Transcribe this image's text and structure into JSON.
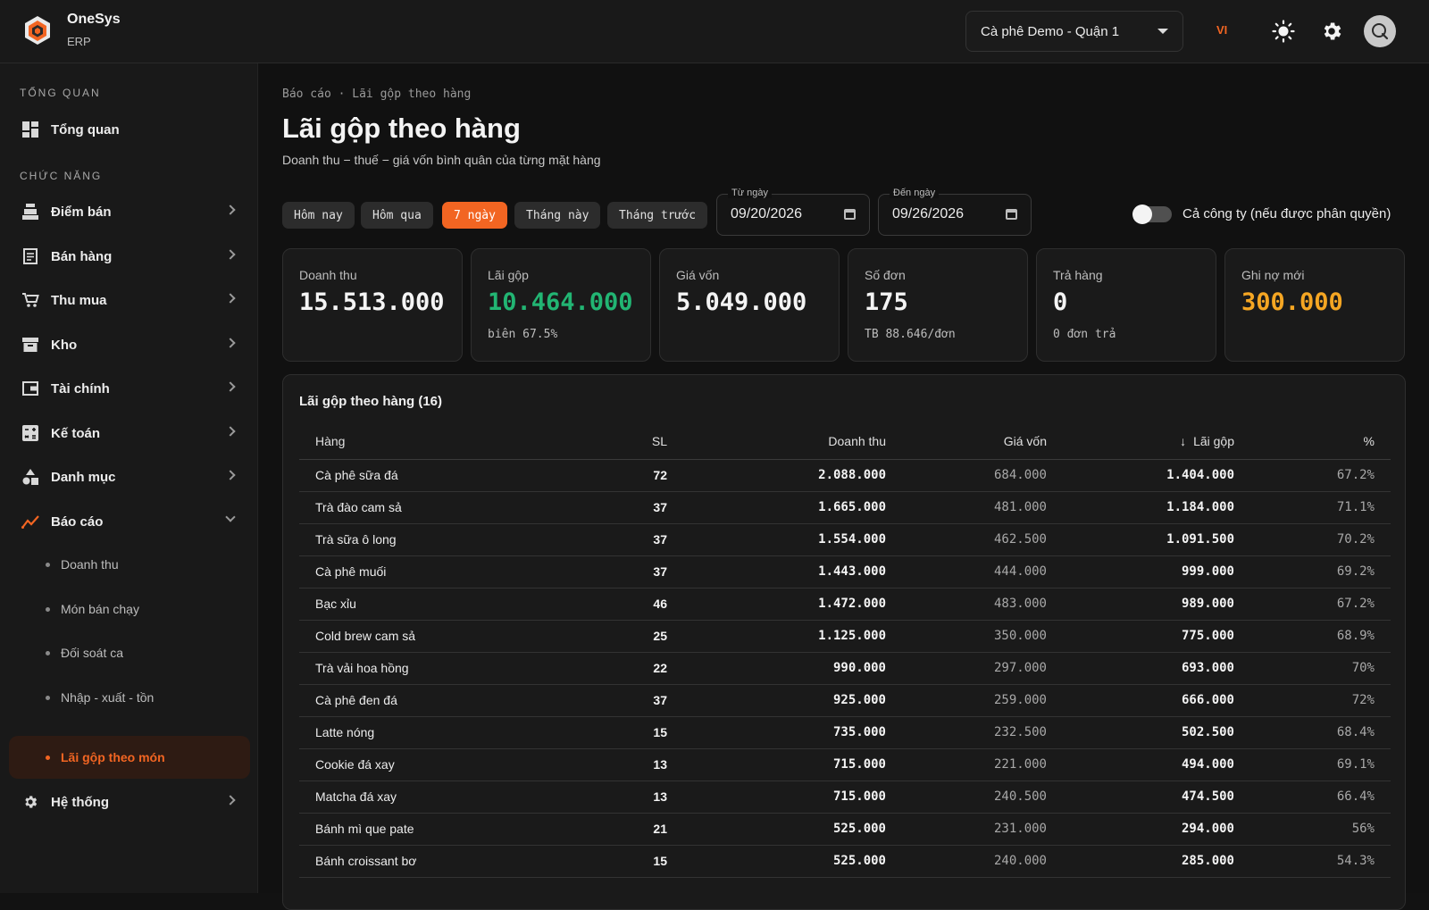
{
  "brand": {
    "name": "OneSys",
    "sub": "ERP"
  },
  "topbar": {
    "store": "Cà phê Demo - Quận 1",
    "lang": "VI"
  },
  "sidebar": {
    "section_overview": "TỔNG QUAN",
    "overview_item": "Tổng quan",
    "section_functions": "CHỨC NĂNG",
    "items": [
      {
        "label": "Điểm bán",
        "icon": "cash-register-icon"
      },
      {
        "label": "Bán hàng",
        "icon": "receipt-icon"
      },
      {
        "label": "Thu mua",
        "icon": "cart-icon"
      },
      {
        "label": "Kho",
        "icon": "archive-icon"
      },
      {
        "label": "Tài chính",
        "icon": "wallet-icon"
      },
      {
        "label": "Kế toán",
        "icon": "calculator-icon"
      },
      {
        "label": "Danh mục",
        "icon": "shapes-icon"
      },
      {
        "label": "Báo cáo",
        "icon": "chart-line-icon"
      }
    ],
    "report_subitems": [
      "Doanh thu",
      "Món bán chạy",
      "Đối soát ca",
      "Nhập - xuất - tồn",
      "Lãi gộp theo món"
    ],
    "system_item": "Hệ thống"
  },
  "main": {
    "breadcrumb": "Báo cáo · Lãi gộp theo hàng",
    "title": "Lãi gộp theo hàng",
    "subtitle": "Doanh thu − thuế − giá vốn bình quân của từng mặt hàng",
    "filters": [
      "Hôm nay",
      "Hôm qua",
      "7 ngày",
      "Tháng này",
      "Tháng trước"
    ],
    "active_filter": "7 ngày",
    "from_label": "Từ ngày",
    "from_value": "09/20/2026",
    "to_label": "Đến ngày",
    "to_value": "09/26/2026",
    "company_toggle_label": "Cả công ty (nếu được phân quyền)",
    "company_toggle_on": false
  },
  "kpis": [
    {
      "label": "Doanh thu",
      "value": "15.513.000",
      "note": ""
    },
    {
      "label": "Lãi gộp",
      "value": "10.464.000",
      "note": "biên 67.5%"
    },
    {
      "label": "Giá vốn",
      "value": "5.049.000",
      "note": ""
    },
    {
      "label": "Số đơn",
      "value": "175",
      "note": "TB 88.646/đơn"
    },
    {
      "label": "Trả hàng",
      "value": "0",
      "note": "0 đơn trả"
    },
    {
      "label": "Ghi nợ mới",
      "value": "300.000",
      "note": ""
    }
  ],
  "colors": {
    "accent": "#f26522",
    "profit": "#22b573",
    "debt": "#f5a623"
  },
  "table": {
    "title": "Lãi gộp theo hàng (16)",
    "headers": [
      "Hàng",
      "SL",
      "Doanh thu",
      "Giá vốn",
      "Lãi gộp",
      "%"
    ],
    "rows": [
      [
        "Cà phê sữa đá",
        "72",
        "2.088.000",
        "684.000",
        "1.404.000",
        "67.2%"
      ],
      [
        "Trà đào cam sả",
        "37",
        "1.665.000",
        "481.000",
        "1.184.000",
        "71.1%"
      ],
      [
        "Trà sữa ô long",
        "37",
        "1.554.000",
        "462.500",
        "1.091.500",
        "70.2%"
      ],
      [
        "Cà phê muối",
        "37",
        "1.443.000",
        "444.000",
        "999.000",
        "69.2%"
      ],
      [
        "Bạc xỉu",
        "46",
        "1.472.000",
        "483.000",
        "989.000",
        "67.2%"
      ],
      [
        "Cold brew cam sả",
        "25",
        "1.125.000",
        "350.000",
        "775.000",
        "68.9%"
      ],
      [
        "Trà vải hoa hồng",
        "22",
        "990.000",
        "297.000",
        "693.000",
        "70%"
      ],
      [
        "Cà phê đen đá",
        "37",
        "925.000",
        "259.000",
        "666.000",
        "72%"
      ],
      [
        "Latte nóng",
        "15",
        "735.000",
        "232.500",
        "502.500",
        "68.4%"
      ],
      [
        "Cookie đá xay",
        "13",
        "715.000",
        "221.000",
        "494.000",
        "69.1%"
      ],
      [
        "Matcha đá xay",
        "13",
        "715.000",
        "240.500",
        "474.500",
        "66.4%"
      ],
      [
        "Bánh mì que pate",
        "21",
        "525.000",
        "231.000",
        "294.000",
        "56%"
      ],
      [
        "Bánh croissant bơ",
        "15",
        "525.000",
        "240.000",
        "285.000",
        "54.3%"
      ]
    ]
  }
}
